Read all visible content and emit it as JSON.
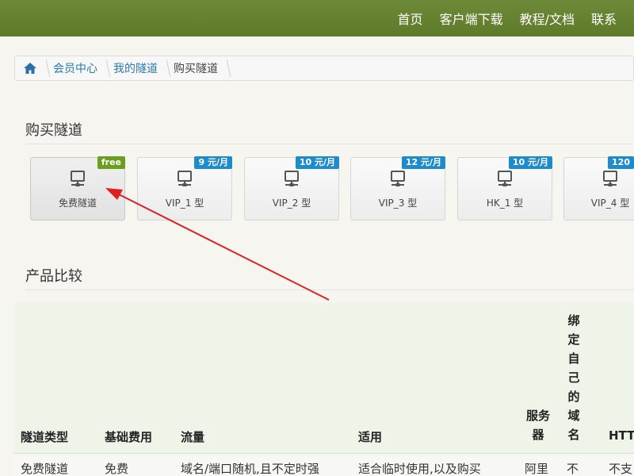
{
  "nav": {
    "items": [
      "首页",
      "客户端下载",
      "教程/文档",
      "联系"
    ]
  },
  "breadcrumb": {
    "items": [
      "会员中心",
      "我的隧道",
      "购买隧道"
    ]
  },
  "sections": {
    "buy_title": "购买隧道",
    "compare_title": "产品比较"
  },
  "plans": [
    {
      "name": "免费隧道",
      "badge": "free",
      "badge_color": "#6a9e1f",
      "icon": "server-icon"
    },
    {
      "name": "VIP_1 型",
      "badge": "9 元/月",
      "badge_color": "#1d8bcc",
      "icon": "server-icon"
    },
    {
      "name": "VIP_2 型",
      "badge": "10 元/月",
      "badge_color": "#1d8bcc",
      "icon": "server-icon"
    },
    {
      "name": "VIP_3 型",
      "badge": "12 元/月",
      "badge_color": "#1d8bcc",
      "icon": "server-icon"
    },
    {
      "name": "HK_1 型",
      "badge": "10 元/月",
      "badge_color": "#1d8bcc",
      "icon": "server-icon"
    },
    {
      "name": "VIP_4 型",
      "badge": "120",
      "badge_color": "#1d8bcc",
      "icon": "server-icon"
    }
  ],
  "table": {
    "headers": {
      "type": "隧道类型",
      "base_fee": "基础费用",
      "traffic": "流量",
      "usage": "适用",
      "server": "服务器",
      "bind_domain": "绑定自己的域名",
      "http": "HTT"
    },
    "row1": {
      "type": "免费隧道",
      "base_fee": "免费",
      "traffic": "域名/端口随机,且不定时强",
      "usage": "适合临时使用,以及购买",
      "server": "阿里",
      "bind_domain": "不",
      "http": "不支"
    }
  },
  "colors": {
    "nav_bg": "#5d7a2a",
    "link": "#2a7ab0",
    "table_header_bg": "#eef5e8",
    "annotation_arrow": "#e02020"
  }
}
